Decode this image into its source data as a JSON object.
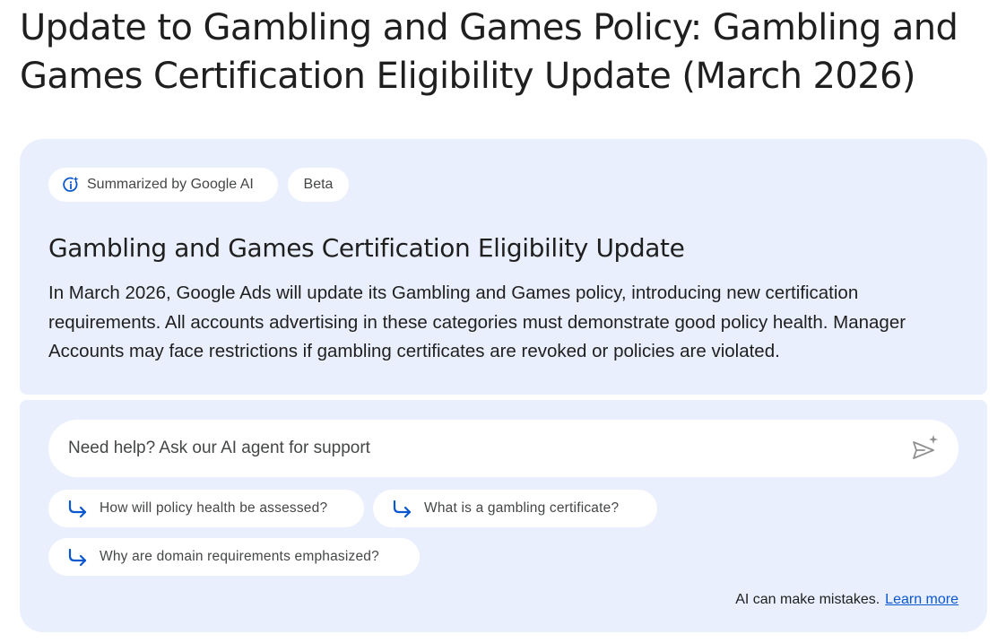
{
  "page": {
    "title": "Update to Gambling and Games Policy: Gambling and Games Certification Eligibility Update (March 2026)"
  },
  "summary": {
    "badge_label": "Summarized by Google AI",
    "beta_label": "Beta",
    "heading": "Gambling and Games Certification Eligibility Update",
    "body": "In March 2026, Google Ads will update its Gambling and Games policy, introducing new certification requirements. All accounts advertising in these categories must demonstrate good policy health. Manager Accounts may face restrictions if gambling certificates are revoked or policies are violated."
  },
  "agent": {
    "input_value": "",
    "input_placeholder": "Need help? Ask our AI agent for support",
    "send_icon": "send-sparkle-icon",
    "suggestion_icon": "arrow-forward-hook-icon",
    "suggestions": [
      {
        "label": "How will policy health be assessed?"
      },
      {
        "label": "What is a gambling certificate?"
      },
      {
        "label": "Why are domain requirements emphasized?"
      }
    ],
    "disclaimer_text": "AI can make mistakes.",
    "learn_more_label": "Learn more"
  },
  "colors": {
    "card_background": "#e9effc",
    "accent_blue": "#0b57d0",
    "text_primary": "#1f1f1f",
    "text_secondary": "#444746"
  }
}
